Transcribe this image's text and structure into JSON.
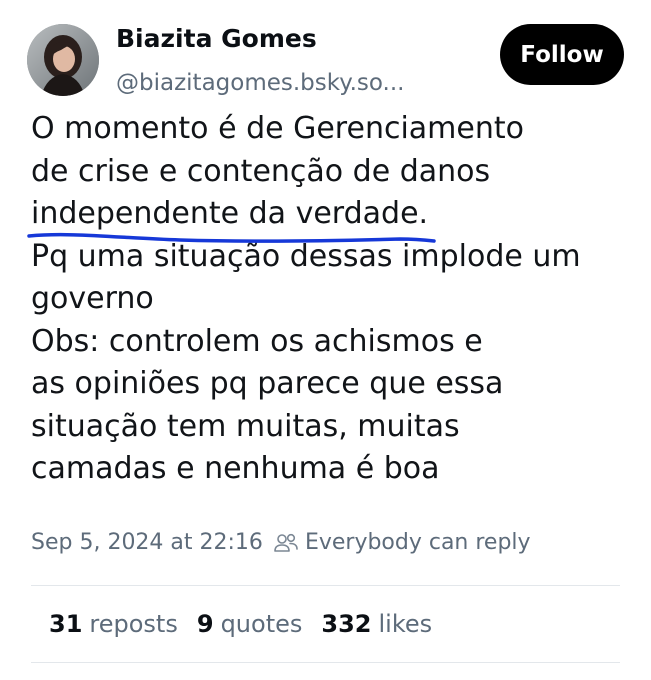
{
  "author": {
    "display_name": "Biazita Gomes",
    "handle": "@biazitagomes.bsky.so..."
  },
  "follow_button": {
    "label": "Follow"
  },
  "post": {
    "lines": [
      "O momento é de Gerenciamento",
      "de crise e contenção de danos",
      "independente da verdade.",
      "Pq uma situação dessas implode um",
      "governo",
      "Obs: controlem os achismos e",
      "as opiniões pq parece que essa",
      "situação tem muitas, muitas",
      "camadas e nenhuma é boa"
    ],
    "timestamp": "Sep 5, 2024 at 22:16",
    "reply_setting": "Everybody can reply",
    "reply_icon": "people-icon"
  },
  "stats": {
    "reposts_count": "31",
    "reposts_label": "reposts",
    "quotes_count": "9",
    "quotes_label": "quotes",
    "likes_count": "332",
    "likes_label": "likes"
  },
  "colors": {
    "text": "#0b0f14",
    "muted": "#5d6b7a",
    "button_bg": "#000000",
    "annotation_underline": "#1638d8"
  }
}
